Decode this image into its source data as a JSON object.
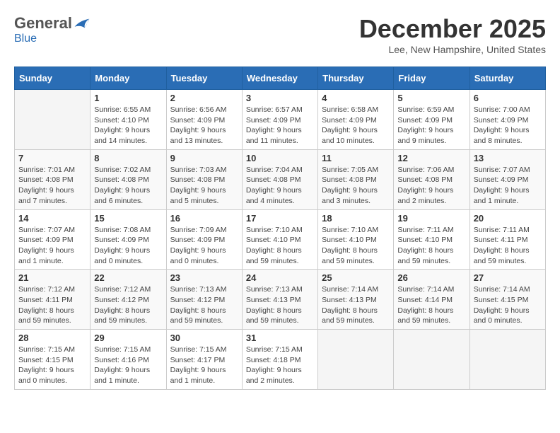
{
  "logo": {
    "general": "General",
    "blue": "Blue"
  },
  "header": {
    "month": "December 2025",
    "location": "Lee, New Hampshire, United States"
  },
  "weekdays": [
    "Sunday",
    "Monday",
    "Tuesday",
    "Wednesday",
    "Thursday",
    "Friday",
    "Saturday"
  ],
  "weeks": [
    [
      {
        "day": "",
        "info": ""
      },
      {
        "day": "1",
        "info": "Sunrise: 6:55 AM\nSunset: 4:10 PM\nDaylight: 9 hours\nand 14 minutes."
      },
      {
        "day": "2",
        "info": "Sunrise: 6:56 AM\nSunset: 4:09 PM\nDaylight: 9 hours\nand 13 minutes."
      },
      {
        "day": "3",
        "info": "Sunrise: 6:57 AM\nSunset: 4:09 PM\nDaylight: 9 hours\nand 11 minutes."
      },
      {
        "day": "4",
        "info": "Sunrise: 6:58 AM\nSunset: 4:09 PM\nDaylight: 9 hours\nand 10 minutes."
      },
      {
        "day": "5",
        "info": "Sunrise: 6:59 AM\nSunset: 4:09 PM\nDaylight: 9 hours\nand 9 minutes."
      },
      {
        "day": "6",
        "info": "Sunrise: 7:00 AM\nSunset: 4:09 PM\nDaylight: 9 hours\nand 8 minutes."
      }
    ],
    [
      {
        "day": "7",
        "info": "Sunrise: 7:01 AM\nSunset: 4:08 PM\nDaylight: 9 hours\nand 7 minutes."
      },
      {
        "day": "8",
        "info": "Sunrise: 7:02 AM\nSunset: 4:08 PM\nDaylight: 9 hours\nand 6 minutes."
      },
      {
        "day": "9",
        "info": "Sunrise: 7:03 AM\nSunset: 4:08 PM\nDaylight: 9 hours\nand 5 minutes."
      },
      {
        "day": "10",
        "info": "Sunrise: 7:04 AM\nSunset: 4:08 PM\nDaylight: 9 hours\nand 4 minutes."
      },
      {
        "day": "11",
        "info": "Sunrise: 7:05 AM\nSunset: 4:08 PM\nDaylight: 9 hours\nand 3 minutes."
      },
      {
        "day": "12",
        "info": "Sunrise: 7:06 AM\nSunset: 4:08 PM\nDaylight: 9 hours\nand 2 minutes."
      },
      {
        "day": "13",
        "info": "Sunrise: 7:07 AM\nSunset: 4:09 PM\nDaylight: 9 hours\nand 1 minute."
      }
    ],
    [
      {
        "day": "14",
        "info": "Sunrise: 7:07 AM\nSunset: 4:09 PM\nDaylight: 9 hours\nand 1 minute."
      },
      {
        "day": "15",
        "info": "Sunrise: 7:08 AM\nSunset: 4:09 PM\nDaylight: 9 hours\nand 0 minutes."
      },
      {
        "day": "16",
        "info": "Sunrise: 7:09 AM\nSunset: 4:09 PM\nDaylight: 9 hours\nand 0 minutes."
      },
      {
        "day": "17",
        "info": "Sunrise: 7:10 AM\nSunset: 4:10 PM\nDaylight: 8 hours\nand 59 minutes."
      },
      {
        "day": "18",
        "info": "Sunrise: 7:10 AM\nSunset: 4:10 PM\nDaylight: 8 hours\nand 59 minutes."
      },
      {
        "day": "19",
        "info": "Sunrise: 7:11 AM\nSunset: 4:10 PM\nDaylight: 8 hours\nand 59 minutes."
      },
      {
        "day": "20",
        "info": "Sunrise: 7:11 AM\nSunset: 4:11 PM\nDaylight: 8 hours\nand 59 minutes."
      }
    ],
    [
      {
        "day": "21",
        "info": "Sunrise: 7:12 AM\nSunset: 4:11 PM\nDaylight: 8 hours\nand 59 minutes."
      },
      {
        "day": "22",
        "info": "Sunrise: 7:12 AM\nSunset: 4:12 PM\nDaylight: 8 hours\nand 59 minutes."
      },
      {
        "day": "23",
        "info": "Sunrise: 7:13 AM\nSunset: 4:12 PM\nDaylight: 8 hours\nand 59 minutes."
      },
      {
        "day": "24",
        "info": "Sunrise: 7:13 AM\nSunset: 4:13 PM\nDaylight: 8 hours\nand 59 minutes."
      },
      {
        "day": "25",
        "info": "Sunrise: 7:14 AM\nSunset: 4:13 PM\nDaylight: 8 hours\nand 59 minutes."
      },
      {
        "day": "26",
        "info": "Sunrise: 7:14 AM\nSunset: 4:14 PM\nDaylight: 8 hours\nand 59 minutes."
      },
      {
        "day": "27",
        "info": "Sunrise: 7:14 AM\nSunset: 4:15 PM\nDaylight: 9 hours\nand 0 minutes."
      }
    ],
    [
      {
        "day": "28",
        "info": "Sunrise: 7:15 AM\nSunset: 4:15 PM\nDaylight: 9 hours\nand 0 minutes."
      },
      {
        "day": "29",
        "info": "Sunrise: 7:15 AM\nSunset: 4:16 PM\nDaylight: 9 hours\nand 1 minute."
      },
      {
        "day": "30",
        "info": "Sunrise: 7:15 AM\nSunset: 4:17 PM\nDaylight: 9 hours\nand 1 minute."
      },
      {
        "day": "31",
        "info": "Sunrise: 7:15 AM\nSunset: 4:18 PM\nDaylight: 9 hours\nand 2 minutes."
      },
      {
        "day": "",
        "info": ""
      },
      {
        "day": "",
        "info": ""
      },
      {
        "day": "",
        "info": ""
      }
    ]
  ]
}
